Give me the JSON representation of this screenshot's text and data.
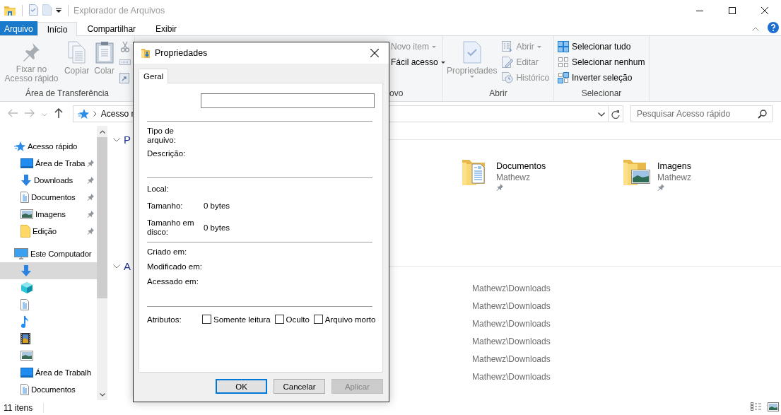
{
  "window": {
    "title": "Explorador de Arquivos"
  },
  "ribbon_tabs": [
    {
      "label": "Arquivo",
      "kind": "file",
      "selected": false
    },
    {
      "label": "Início",
      "kind": "tab",
      "selected": true
    },
    {
      "label": "Compartilhar",
      "kind": "tab",
      "selected": false
    },
    {
      "label": "Exibir",
      "kind": "tab",
      "selected": false
    }
  ],
  "ribbon_groups": [
    {
      "label": "Área de Transferência",
      "commands": [
        {
          "label": "Fixar no Acesso rápido",
          "kind": "large",
          "disabled": true
        },
        {
          "label": "Copiar",
          "kind": "large",
          "disabled": true
        },
        {
          "label": "Colar",
          "kind": "large",
          "disabled": true
        },
        {
          "kind": "small"
        },
        {
          "kind": "small"
        },
        {
          "kind": "small"
        }
      ]
    },
    {
      "label": "ovo",
      "commands": [
        {
          "label": "Novo item",
          "kind": "small",
          "dropdown": true,
          "disabled": true
        },
        {
          "label": "Fácil acesso",
          "kind": "small",
          "dropdown": true,
          "disabled": false
        }
      ]
    },
    {
      "label": "Abrir",
      "commands": [
        {
          "label": "Propriedades",
          "kind": "large",
          "dropdown": true,
          "disabled": true
        },
        {
          "label": "Abrir",
          "kind": "small",
          "dropdown": true,
          "disabled": true
        },
        {
          "label": "Editar",
          "kind": "small",
          "disabled": true
        },
        {
          "label": "Histórico",
          "kind": "small",
          "disabled": true
        }
      ]
    },
    {
      "label": "Selecionar",
      "commands": [
        {
          "label": "Selecionar tudo",
          "kind": "small",
          "disabled": false
        },
        {
          "label": "Selecionar nenhum",
          "kind": "small",
          "disabled": false
        },
        {
          "label": "Inverter seleção",
          "kind": "small",
          "disabled": false
        }
      ]
    }
  ],
  "address": {
    "segments": [
      "Acesso r"
    ]
  },
  "search": {
    "placeholder": "Pesquisar Acesso rápido"
  },
  "sidebar": {
    "sections": [
      {
        "label": "Acesso rápido",
        "selected": false,
        "children": [
          {
            "label": "Área de Traba",
            "pinned": true,
            "selected": false
          },
          {
            "label": "Downloads",
            "pinned": true,
            "selected": false
          },
          {
            "label": "Documentos",
            "pinned": true,
            "selected": false
          },
          {
            "label": "Imagens",
            "pinned": true,
            "selected": false
          },
          {
            "label": "Edição",
            "pinned": true,
            "selected": false
          }
        ]
      },
      {
        "label": "Este Computador",
        "selected": false,
        "children": [
          {
            "selected": true
          },
          {
            "selected": false
          },
          {
            "selected": false
          },
          {
            "selected": false
          },
          {
            "selected": false
          },
          {
            "selected": false
          },
          {
            "label": "Área de Trabalh",
            "selected": false
          },
          {
            "label": "Documentos",
            "selected": false
          }
        ]
      }
    ]
  },
  "content": {
    "sections": [
      {
        "heading": "P",
        "expanded": true,
        "folders": [
          {
            "name": "Documentos",
            "owner": "Mathewz",
            "pinned": true
          },
          {
            "name": "Imagens",
            "owner": "Mathewz",
            "pinned": true
          }
        ]
      },
      {
        "heading": "A",
        "expanded": true,
        "recent": [
          "Mathewz\\Downloads",
          "Mathewz\\Downloads",
          "Mathewz\\Downloads",
          "Mathewz\\Downloads",
          "Mathewz\\Downloads",
          "Mathewz\\Downloads"
        ]
      }
    ]
  },
  "status_bar": {
    "item_count": "11 itens"
  },
  "dialog": {
    "title": "Propriedades",
    "tabs": [
      {
        "label": "Geral",
        "selected": true
      }
    ],
    "sections": [
      {
        "rows": [
          {
            "label": "Tipo de arquivo:"
          },
          {
            "label": "Descrição:"
          }
        ]
      },
      {
        "rows": [
          {
            "label": "Local:"
          },
          {
            "label": "Tamanho:",
            "value": "0 bytes"
          },
          {
            "label": "Tamanho em disco:",
            "value": "0 bytes"
          }
        ]
      },
      {
        "rows": [
          {
            "label": "Criado em:"
          },
          {
            "label": "Modificado em:"
          },
          {
            "label": "Acessado em:"
          }
        ]
      }
    ],
    "attributes": {
      "label": "Atributos:",
      "options": [
        {
          "label": "Somente leitura",
          "checked": false
        },
        {
          "label": "Oculto",
          "checked": false
        },
        {
          "label": "Arquivo morto",
          "checked": false
        }
      ]
    },
    "buttons": [
      {
        "label": "OK",
        "default": true,
        "disabled": false
      },
      {
        "label": "Cancelar",
        "default": false,
        "disabled": false
      },
      {
        "label": "Aplicar",
        "default": false,
        "disabled": true
      }
    ]
  }
}
